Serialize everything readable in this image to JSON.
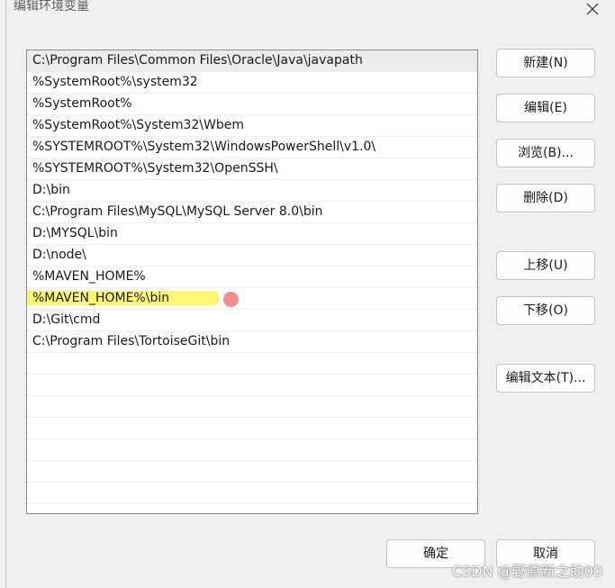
{
  "dialog": {
    "title": "编辑环境变量"
  },
  "path_entries": [
    "C:\\Program Files\\Common Files\\Oracle\\Java\\javapath",
    "%SystemRoot%\\system32",
    "%SystemRoot%",
    "%SystemRoot%\\System32\\Wbem",
    "%SYSTEMROOT%\\System32\\WindowsPowerShell\\v1.0\\",
    "%SYSTEMROOT%\\System32\\OpenSSH\\",
    "D:\\bin",
    "C:\\Program Files\\MySQL\\MySQL Server 8.0\\bin",
    "D:\\MYSQL\\bin",
    "D:\\node\\",
    "%MAVEN_HOME%",
    "%MAVEN_HOME%\\bin",
    "D:\\Git\\cmd",
    "C:\\Program Files\\TortoiseGit\\bin",
    "",
    "",
    "",
    "",
    "",
    "",
    "",
    ""
  ],
  "buttons": {
    "new": "新建(N)",
    "edit": "编辑(E)",
    "browse": "浏览(B)...",
    "delete": "删除(D)",
    "move_up": "上移(U)",
    "move_down": "下移(O)",
    "edit_text": "编辑文本(T)...",
    "ok": "确定",
    "cancel": "取消"
  },
  "watermark": "CSDN @野原新之助00",
  "colors": {
    "highlight": "#fbf76f",
    "dot": "#f08d8d",
    "dialog_bg": "#f0f0f0"
  }
}
